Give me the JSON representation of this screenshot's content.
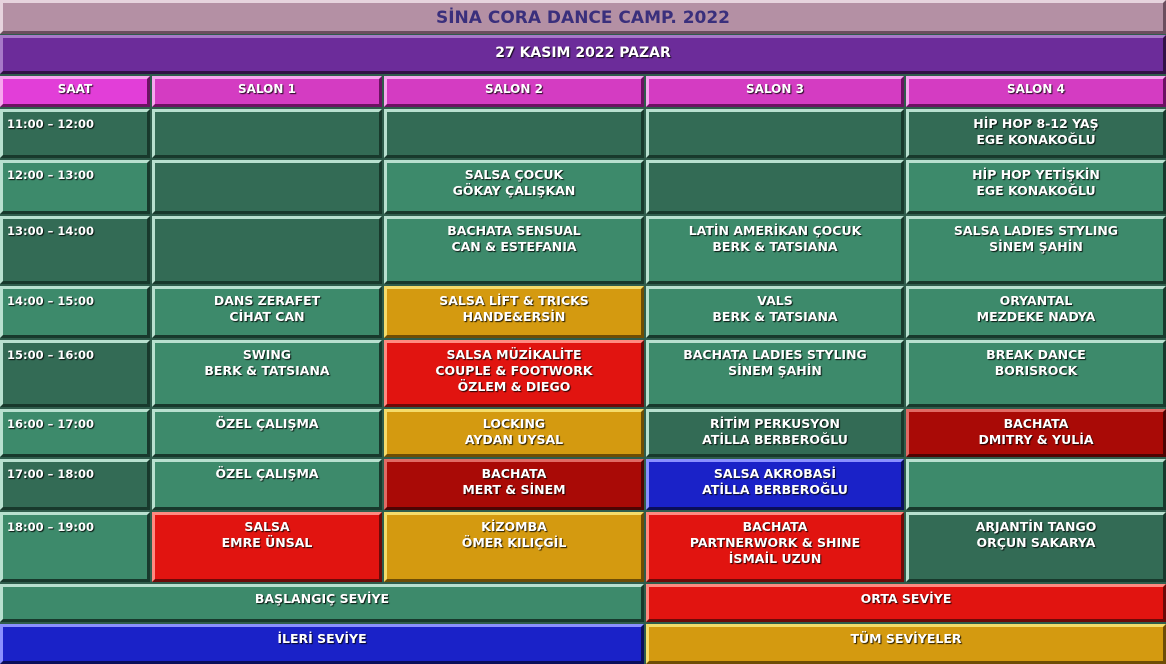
{
  "title": "SİNA CORA DANCE CAMP. 2022",
  "date": "27 KASIM 2022 PAZAR",
  "headers": [
    "SAAT",
    "SALON 1",
    "SALON 2",
    "SALON 3",
    "SALON 4"
  ],
  "times": [
    "11:00 – 12:00",
    "12:00 – 13:00",
    "13:00 – 14:00",
    "14:00 – 15:00",
    "15:00 – 16:00",
    "16:00 – 17:00",
    "17:00 – 18:00",
    "18:00 – 19:00"
  ],
  "schedule": [
    [
      "",
      "",
      "",
      "HİP HOP 8-12  YAŞ\nEGE KONAKOĞLU"
    ],
    [
      "",
      "SALSA ÇOCUK\nGÖKAY ÇALIŞKAN",
      "",
      "HİP HOP YETİŞKİN\nEGE KONAKOĞLU"
    ],
    [
      "",
      "BACHATA SENSUAL\nCAN & ESTEFANIA",
      "LATİN AMERİKAN ÇOCUK\nBERK & TATSIANA",
      "SALSA LADIES STYLING\nSİNEM ŞAHİN"
    ],
    [
      "DANS ZERAFET\nCİHAT CAN",
      "SALSA LİFT & TRICKS\nHANDE&ERSİN",
      "VALS\nBERK & TATSIANA",
      "ORYANTAL\nMEZDEKE NADYA"
    ],
    [
      "SWING\nBERK & TATSIANA",
      "SALSA MÜZİKALİTE\nCOUPLE & FOOTWORK\nÖZLEM & DIEGO",
      "BACHATA LADIES STYLING\nSİNEM ŞAHİN",
      "BREAK DANCE\nBORISROCK"
    ],
    [
      "ÖZEL ÇALIŞMA",
      "LOCKING\nAYDAN UYSAL",
      "RİTİM PERKUSYON\nATİLLA BERBEROĞLU",
      "BACHATA\nDMITRY & YULİA"
    ],
    [
      "ÖZEL ÇALIŞMA",
      "BACHATA\nMERT & SİNEM",
      "SALSA AKROBASİ\nATİLLA BERBEROĞLU",
      ""
    ],
    [
      "SALSA\nEMRE ÜNSAL",
      "KİZOMBA\nÖMER KILIÇGİL",
      "BACHATA\nPARTNERWORK & SHINE\nİSMAİL UZUN",
      "ARJANTİN TANGO\nORÇUN SAKARYA"
    ]
  ],
  "level_colors": [
    [
      "",
      "",
      "",
      ""
    ],
    [
      "",
      "green",
      "",
      "green"
    ],
    [
      "",
      "green",
      "green",
      "green"
    ],
    [
      "green",
      "yellow",
      "green",
      "green"
    ],
    [
      "green",
      "red",
      "green",
      "green"
    ],
    [
      "green",
      "yellow",
      "dkgreen",
      "dkred"
    ],
    [
      "green",
      "dkred",
      "blue",
      "green"
    ],
    [
      "red",
      "yellow",
      "red",
      "dkgreen"
    ]
  ],
  "legend": {
    "beginner": "BAŞLANGIÇ SEVİYE",
    "intermediate": "ORTA SEVİYE",
    "advanced": "İLERİ SEVİYE",
    "all_levels": "TÜM SEVİYELER"
  },
  "colors": {
    "beginner": "#3d8a6b",
    "intermediate": "#e11410",
    "advanced": "#1a22c8",
    "all_levels": "#d49a10",
    "header": "#d43cc2",
    "date_bar": "#6c2c9a",
    "title_bar": "#b490a4"
  }
}
